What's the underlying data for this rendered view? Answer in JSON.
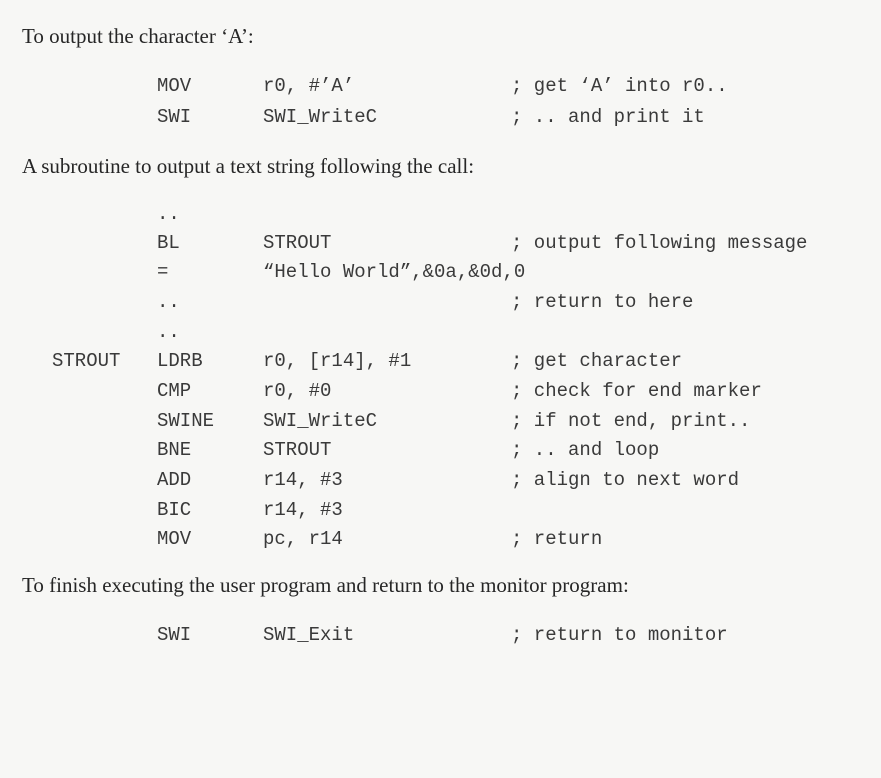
{
  "paragraphs": [
    "To output the character ‘A’:",
    "A subroutine to output a text string following the call:",
    "To finish executing the user program and return to the monitor program:"
  ],
  "code_blocks": [
    [
      {
        "label": "",
        "op": "MOV",
        "arg": "r0, #’A’",
        "comment": "; get ‘A’ into r0.."
      },
      {
        "label": "",
        "op": "SWI",
        "arg": "SWI_WriteC",
        "comment": "; .. and print it"
      }
    ],
    [
      {
        "label": "",
        "op": "..",
        "arg": "",
        "comment": ""
      },
      {
        "label": "",
        "op": "BL",
        "arg": "STROUT",
        "comment": "; output following message"
      },
      {
        "label": "",
        "op": "=",
        "arg": "“Hello World”,&0a,&0d,0",
        "comment": ""
      },
      {
        "label": "",
        "op": "..",
        "arg": "",
        "comment": "; return to here"
      },
      {
        "label": "",
        "op": "..",
        "arg": "",
        "comment": ""
      },
      {
        "label": "STROUT",
        "op": "LDRB",
        "arg": "r0, [r14], #1",
        "comment": "; get character"
      },
      {
        "label": "",
        "op": "CMP",
        "arg": "r0, #0",
        "comment": "; check for end marker"
      },
      {
        "label": "",
        "op": "SWINE",
        "arg": "SWI_WriteC",
        "comment": "; if not end, print.."
      },
      {
        "label": "",
        "op": "BNE",
        "arg": "STROUT",
        "comment": "; .. and loop"
      },
      {
        "label": "",
        "op": "ADD",
        "arg": "r14, #3",
        "comment": "; align to next word"
      },
      {
        "label": "",
        "op": "BIC",
        "arg": "r14, #3",
        "comment": ""
      },
      {
        "label": "",
        "op": "MOV",
        "arg": "pc, r14",
        "comment": "; return"
      }
    ],
    [
      {
        "label": "",
        "op": "SWI",
        "arg": "SWI_Exit",
        "comment": "; return to monitor"
      }
    ]
  ]
}
